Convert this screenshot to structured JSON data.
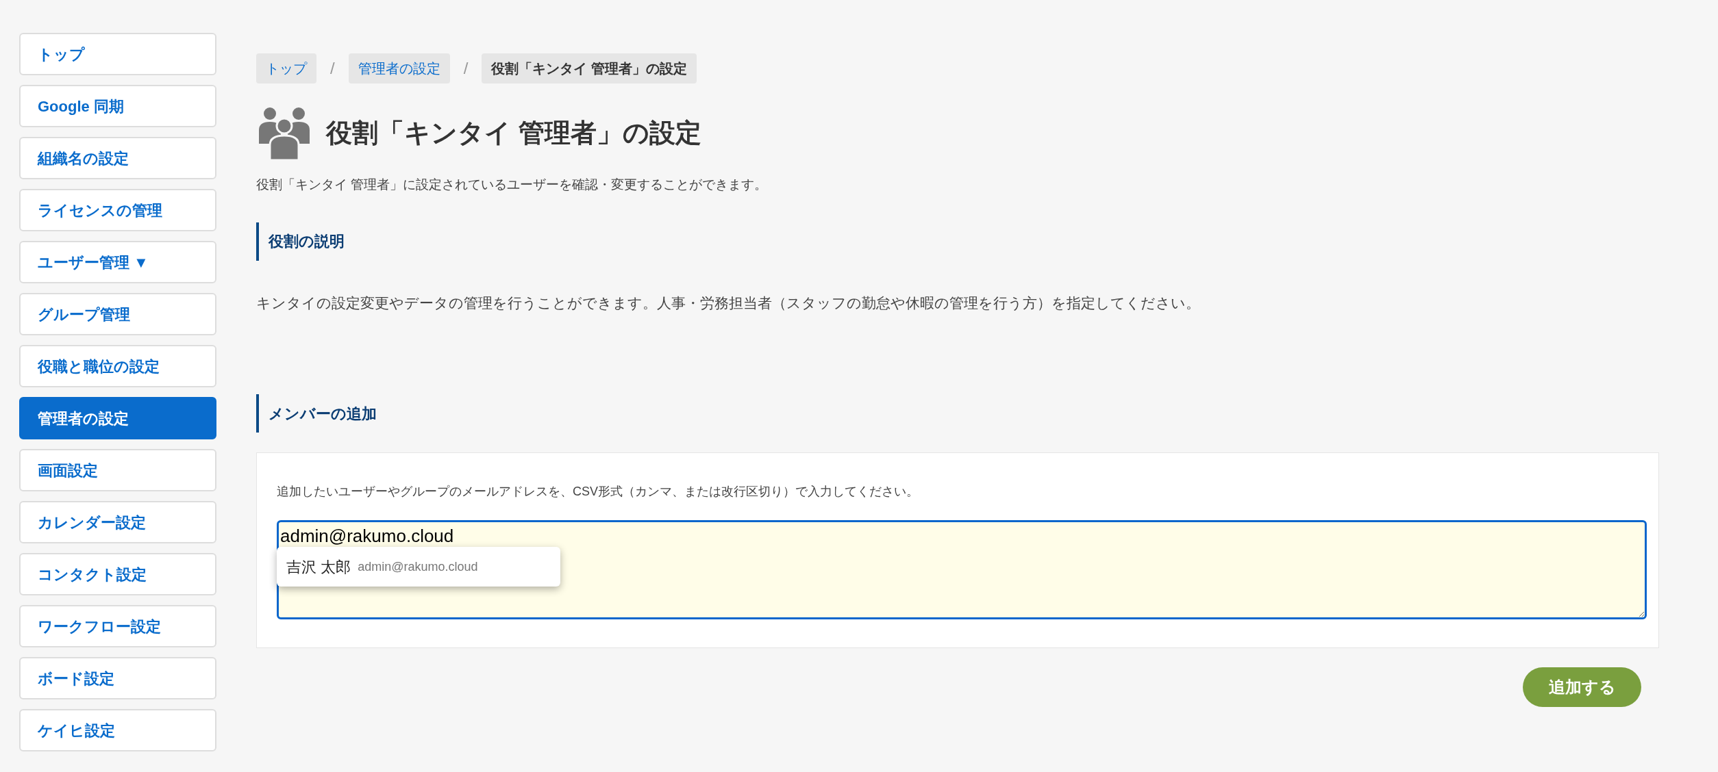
{
  "sidebar": {
    "items": [
      {
        "label": "トップ",
        "selected": false
      },
      {
        "label": "Google 同期",
        "selected": false
      },
      {
        "label": "組織名の設定",
        "selected": false
      },
      {
        "label": "ライセンスの管理",
        "selected": false
      },
      {
        "label": "ユーザー管理 ▼",
        "selected": false
      },
      {
        "label": "グループ管理",
        "selected": false
      },
      {
        "label": "役職と職位の設定",
        "selected": false
      },
      {
        "label": "管理者の設定",
        "selected": true
      },
      {
        "label": "画面設定",
        "selected": false
      },
      {
        "label": "カレンダー設定",
        "selected": false
      },
      {
        "label": "コンタクト設定",
        "selected": false
      },
      {
        "label": "ワークフロー設定",
        "selected": false
      },
      {
        "label": "ボード設定",
        "selected": false
      },
      {
        "label": "ケイヒ設定",
        "selected": false
      }
    ]
  },
  "breadcrumb": [
    {
      "label": "トップ",
      "kind": "link"
    },
    {
      "label": "管理者の設定",
      "kind": "link"
    },
    {
      "label": "役割「キンタイ 管理者」の設定",
      "kind": "current"
    }
  ],
  "breadcrumb_separator": "/",
  "page": {
    "title": "役割「キンタイ 管理者」の設定",
    "description": "役割「キンタイ 管理者」に設定されているユーザーを確認・変更することができます。"
  },
  "role_description": {
    "heading": "役割の説明",
    "text": "キンタイの設定変更やデータの管理を行うことができます。人事・労務担当者（スタッフの勤怠や休暇の管理を行う方）を指定してください。"
  },
  "add_members": {
    "heading": "メンバーの追加",
    "instruction": "追加したいユーザーやグループのメールアドレスを、CSV形式（カンマ、または改行区切り）で入力してください。",
    "value": "admin@rakumo.cloud",
    "suggestion": {
      "name": "吉沢 太郎",
      "email": "admin@rakumo.cloud"
    },
    "button": "追加する"
  }
}
